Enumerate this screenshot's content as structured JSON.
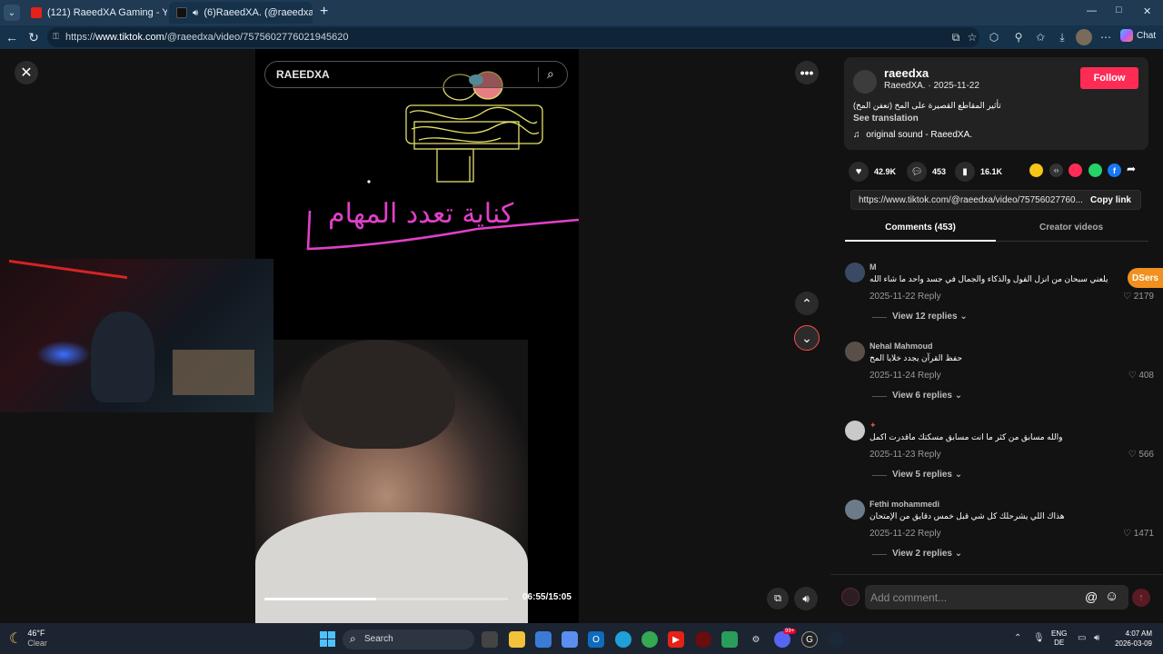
{
  "browser": {
    "tabs": [
      {
        "label": "(121) RaeedXA Gaming - YouTube",
        "favicon_color": "#e62117"
      },
      {
        "label": "(6)RaeedXA. (@raeedxa) | TikT",
        "favicon_color": "#111111"
      }
    ],
    "new_tab": "+",
    "url_prefix": "https://",
    "url_host": "www.tiktok.com",
    "url_path": "/@raeedxa/video/7575602776021945620",
    "chat_label": "Chat",
    "window_controls": [
      "—",
      "□",
      "✕"
    ]
  },
  "video": {
    "search_text": "RAEEDXA",
    "time": "06:55/15:05",
    "progress": 0.46,
    "arabic_overlay": "كناية تعدد المهام"
  },
  "author": {
    "username": "raeedxa",
    "display": "RaeedXA.",
    "date": "2025-11-22",
    "follow_label": "Follow",
    "description": "تأثير المقاطع القصيرة على المخ (تعفن المخ)",
    "see_translation": "See translation",
    "sound": "original sound - RaeedXA."
  },
  "stats": {
    "likes": "42.9K",
    "comments": "453",
    "saves": "16.1K"
  },
  "link": {
    "url": "https://www.tiktok.com/@raeedxa/video/75756027760...",
    "copy_label": "Copy link"
  },
  "tabs": {
    "comments": "Comments (453)",
    "creator": "Creator videos"
  },
  "comments": [
    {
      "name": "M",
      "text": "يلعني سبحان من انزل الفول والذكاء والجمال في جسد واحد ما شاء الله",
      "date": "2025-11-22",
      "reply": "Reply",
      "likes": "2179",
      "view": "View 12 replies",
      "avatar_color": "#3b4a63"
    },
    {
      "name": "Nehal Mahmoud",
      "text": "حفظ القرآن يجدد خلايا المخ",
      "date": "2025-11-24",
      "reply": "Reply",
      "likes": "408",
      "view": "View 6 replies",
      "avatar_color": "#5a4e49"
    },
    {
      "name": "",
      "text": "والله مسابق من كثر ما انت مسابق مسكتك ماقدرت اكمل",
      "date": "2025-11-23",
      "reply": "Reply",
      "likes": "566",
      "view": "View 5 replies",
      "avatar_color": "#c9c9c9"
    },
    {
      "name": "Fethi mohammedi",
      "text": "هذاك اللي يشرحلك كل شي قبل خمس دقايق من الإمتحان",
      "date": "2025-11-22",
      "reply": "Reply",
      "likes": "1471",
      "view": "View 2 replies",
      "avatar_color": "#6d7a8a"
    }
  ],
  "dsers": "DSers",
  "add_comment": "Add comment...",
  "taskbar": {
    "weather_temp": "46°F",
    "weather_desc": "Clear",
    "search": "Search",
    "lang1": "ENG",
    "lang2": "DE",
    "time": "4:07 AM",
    "date": "2026-03-09",
    "badge": "99+"
  }
}
